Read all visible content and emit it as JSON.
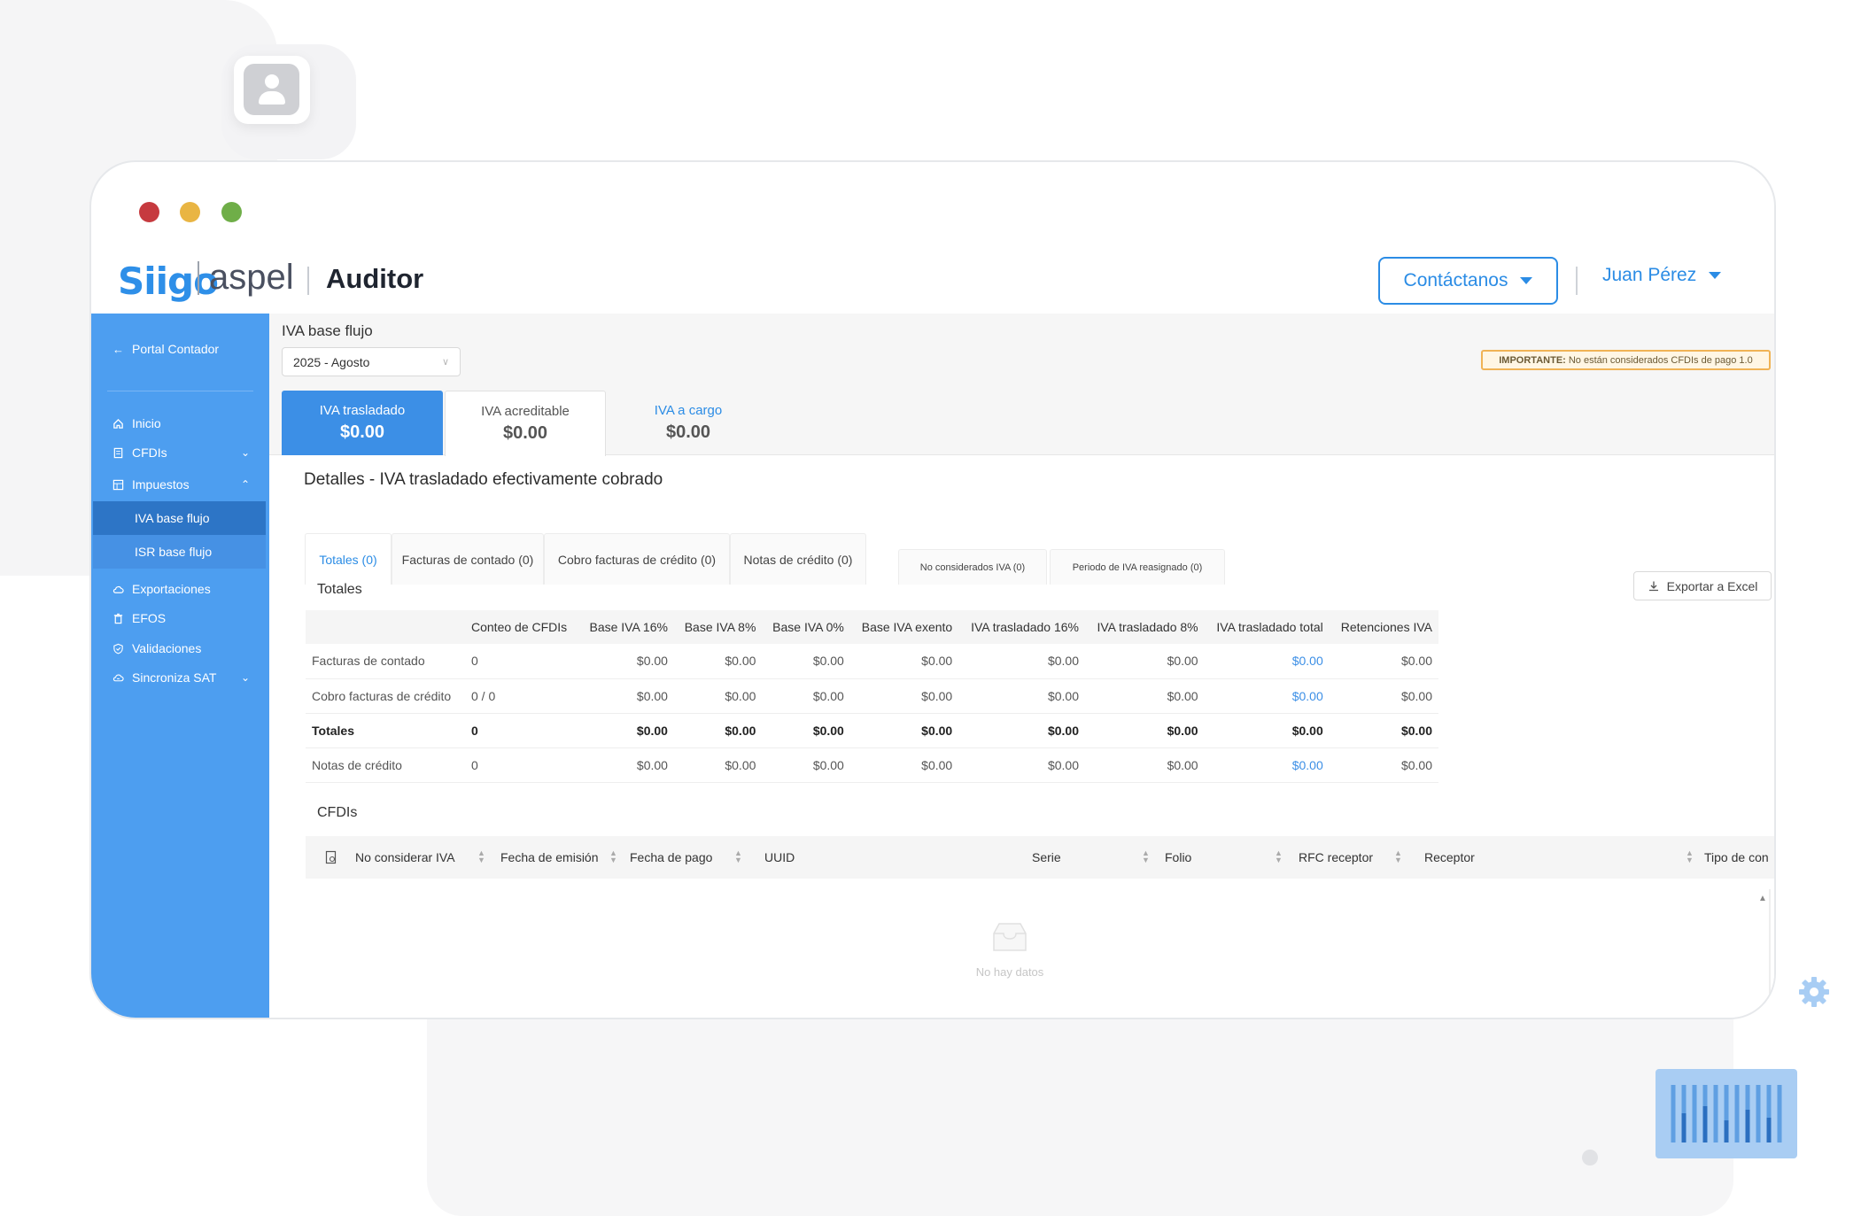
{
  "brand": {
    "logo_siigo": "Siigo",
    "logo_aspel": "aspel",
    "app_name": "Auditor"
  },
  "header": {
    "contact_label": "Contáctanos",
    "user_name": "Juan Pérez"
  },
  "sidebar": {
    "back_label": "Portal Contador",
    "items": [
      {
        "label": "Inicio",
        "icon": "home-icon"
      },
      {
        "label": "CFDIs",
        "icon": "document-icon"
      },
      {
        "label": "Impuestos",
        "icon": "tax-icon"
      },
      {
        "label": "Exportaciones",
        "icon": "cloud-icon"
      },
      {
        "label": "EFOS",
        "icon": "trash-icon"
      },
      {
        "label": "Validaciones",
        "icon": "shield-check-icon"
      },
      {
        "label": "Sincroniza SAT",
        "icon": "sync-icon"
      }
    ],
    "subitems": [
      {
        "label": "IVA base flujo",
        "active": true
      },
      {
        "label": "ISR base flujo",
        "active": false
      }
    ]
  },
  "page": {
    "title": "IVA base flujo",
    "period_value": "2025 - Agosto",
    "important_prefix": "IMPORTANTE:",
    "important_text": "No están considerados CFDIs de pago 1.0"
  },
  "summary_cards": [
    {
      "label": "IVA trasladado",
      "value": "$0.00"
    },
    {
      "label": "IVA acreditable",
      "value": "$0.00"
    },
    {
      "label": "IVA a cargo",
      "value": "$0.00"
    }
  ],
  "details": {
    "title": "Detalles - IVA trasladado efectivamente cobrado",
    "tabs": [
      "Totales (0)",
      "Facturas de contado (0)",
      "Cobro facturas de crédito (0)",
      "Notas de crédito (0)",
      "No considerados IVA (0)",
      "Periodo de IVA reasignado (0)"
    ],
    "export_label": "Exportar a Excel",
    "totals_title": "Totales",
    "totals_table": {
      "columns": [
        "",
        "Conteo de CFDIs",
        "Base IVA 16%",
        "Base IVA 8%",
        "Base IVA 0%",
        "Base IVA exento",
        "IVA trasladado 16%",
        "IVA trasladado 8%",
        "IVA trasladado total",
        "Retenciones IVA"
      ],
      "rows": [
        [
          "Facturas de contado",
          "0",
          "$0.00",
          "$0.00",
          "$0.00",
          "$0.00",
          "$0.00",
          "$0.00",
          "$0.00",
          "$0.00"
        ],
        [
          "Cobro facturas de crédito",
          "0 / 0",
          "$0.00",
          "$0.00",
          "$0.00",
          "$0.00",
          "$0.00",
          "$0.00",
          "$0.00",
          "$0.00"
        ],
        [
          "Totales",
          "0",
          "$0.00",
          "$0.00",
          "$0.00",
          "$0.00",
          "$0.00",
          "$0.00",
          "$0.00",
          "$0.00"
        ],
        [
          "Notas de crédito",
          "0",
          "$0.00",
          "$0.00",
          "$0.00",
          "$0.00",
          "$0.00",
          "$0.00",
          "$0.00",
          "$0.00"
        ]
      ]
    },
    "cfdis_title": "CFDIs",
    "cfdis_columns": [
      "No considerar IVA",
      "Fecha de emisión",
      "Fecha de pago",
      "UUID",
      "Serie",
      "Folio",
      "RFC receptor",
      "Receptor",
      "Tipo de con"
    ],
    "empty_text": "No hay datos"
  },
  "colors": {
    "primary": "#2b8ce5",
    "sidebar": "#4d9ef0",
    "sidebar_active": "#2d75c6"
  }
}
